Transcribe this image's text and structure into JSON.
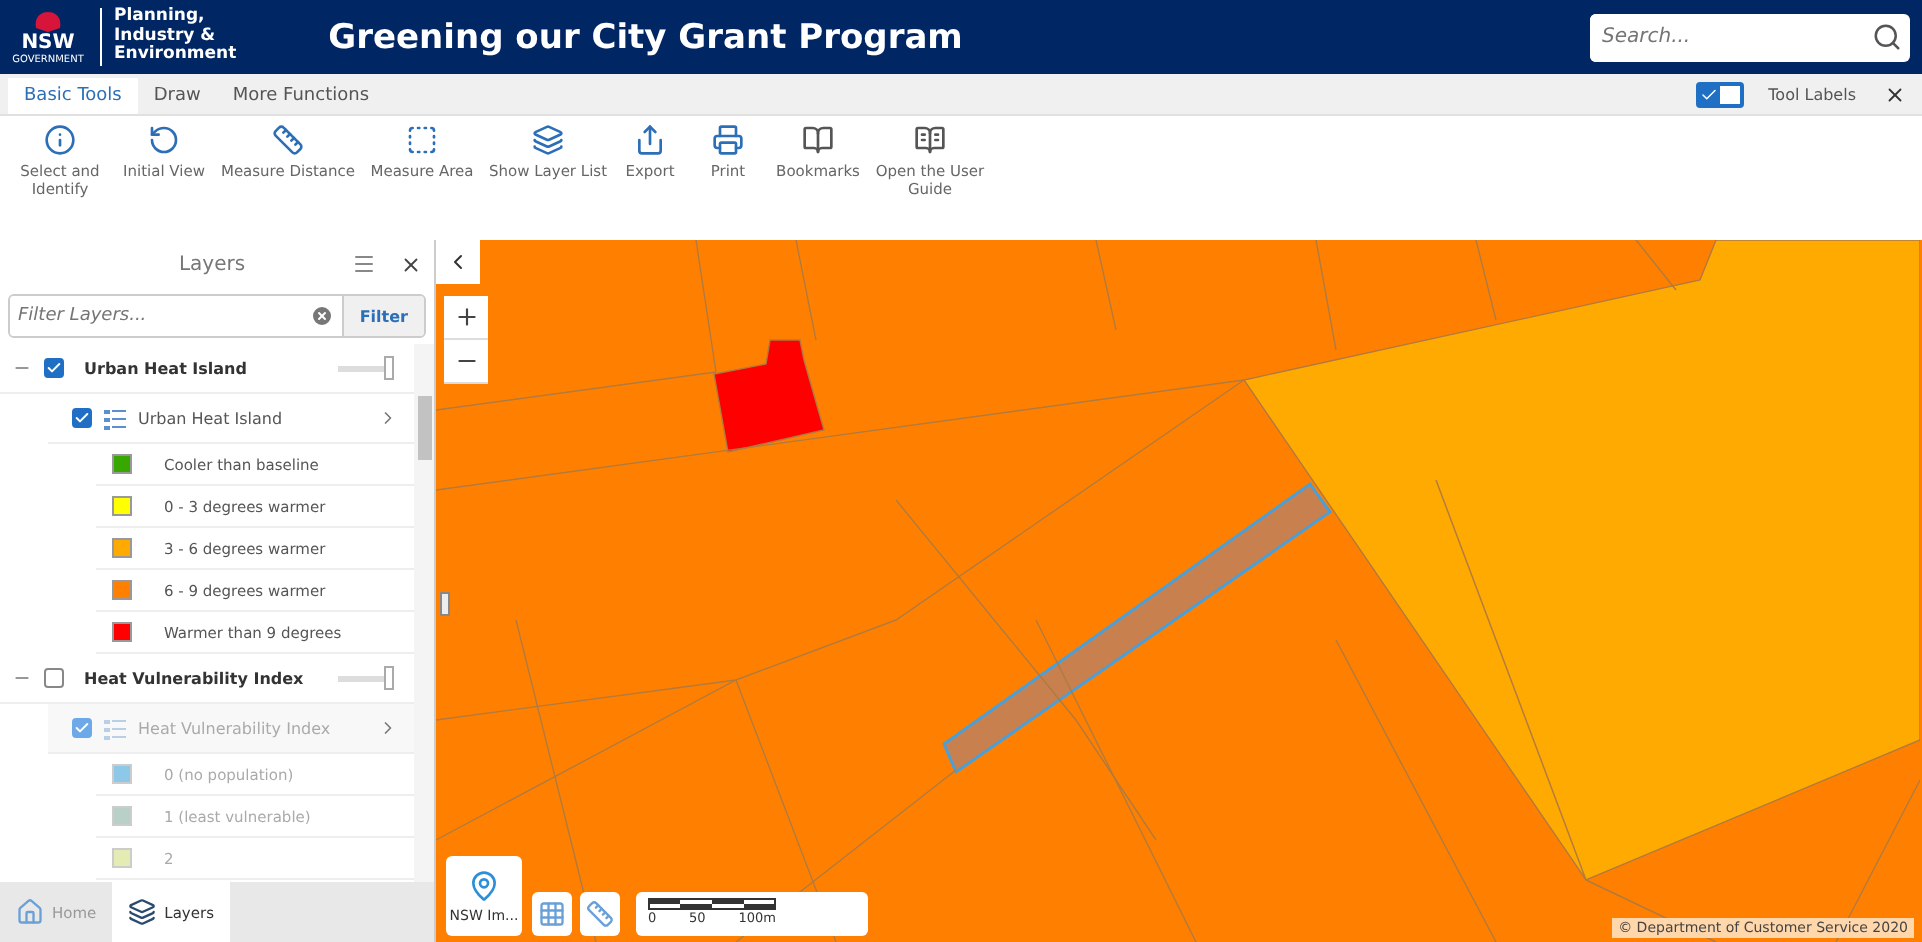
{
  "header": {
    "logo_text": "NSW",
    "logo_subtext": "GOVERNMENT",
    "org_lines": [
      "Planning,",
      "Industry &",
      "Environment"
    ],
    "title": "Greening our City Grant Program",
    "search": {
      "placeholder": "Search..."
    }
  },
  "tabs": [
    {
      "label": "Basic Tools",
      "selected": true
    },
    {
      "label": "Draw",
      "selected": false
    },
    {
      "label": "More Functions",
      "selected": false
    }
  ],
  "tool_labels": {
    "label": "Tool Labels",
    "checked": true
  },
  "tools": [
    {
      "label": "Select and Identify"
    },
    {
      "label": "Initial View"
    },
    {
      "label": "Measure Distance"
    },
    {
      "label": "Measure Area"
    },
    {
      "label": "Show Layer List"
    },
    {
      "label": "Export"
    },
    {
      "label": "Print"
    },
    {
      "label": "Bookmarks"
    },
    {
      "label": "Open the User Guide"
    }
  ],
  "layers_panel": {
    "title": "Layers",
    "filter_placeholder": "Filter Layers...",
    "filter_button": "Filter",
    "groups": [
      {
        "name": "Urban Heat Island",
        "checked": true,
        "expanded": true,
        "level": 1,
        "children": [
          {
            "name": "Urban Heat Island",
            "checked": true,
            "disabled": false,
            "legend": [
              {
                "label": "Cooler than baseline",
                "color": "#38a800"
              },
              {
                "label": "0 - 3 degrees warmer",
                "color": "#ffff00"
              },
              {
                "label": "3 - 6 degrees warmer",
                "color": "#ffaa00"
              },
              {
                "label": "6 - 9 degrees warmer",
                "color": "#ff8000"
              },
              {
                "label": "Warmer than 9 degrees",
                "color": "#ff0000"
              }
            ]
          }
        ]
      },
      {
        "name": "Heat Vulnerability Index",
        "checked": false,
        "expanded": true,
        "level": 1,
        "children": [
          {
            "name": "Heat Vulnerability Index",
            "checked": true,
            "disabled": true,
            "legend": [
              {
                "label": "0 (no population)",
                "color": "#8ec8e8"
              },
              {
                "label": "1 (least vulnerable)",
                "color": "#b8d0c8"
              },
              {
                "label": "2",
                "color": "#e4ecb4"
              }
            ]
          }
        ]
      }
    ]
  },
  "bottom_tabs": [
    {
      "label": "Home",
      "selected": false
    },
    {
      "label": "Layers",
      "selected": true
    }
  ],
  "map": {
    "basemap_label": "NSW Im...",
    "scale_labels": [
      "0",
      "50",
      "100m"
    ],
    "attribution": "© Department of Customer Service 2020"
  }
}
